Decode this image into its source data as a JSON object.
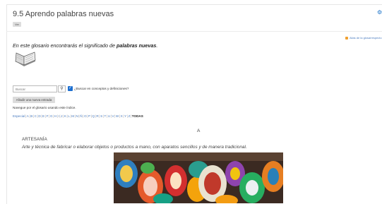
{
  "page": {
    "title": "9.5 Aprendo palabras nuevas",
    "edit_badge": "Ver"
  },
  "links": {
    "rss": "Alias de la glosa/respecto"
  },
  "intro": {
    "prefix": "En este glosario encontrarás el significado de ",
    "highlight": "palabras nuevas",
    "suffix": "."
  },
  "search": {
    "placeholder": "Buscar",
    "button_icon": "search-icon",
    "checkbox_label": "¿Buscar en conceptos y definiciones?",
    "checkbox_checked": true
  },
  "add_entry": {
    "label": "Añadir una nueva entrada"
  },
  "browse": {
    "text": "Navegue por el glosario usando este índice."
  },
  "letter_index": {
    "items": [
      "Especial",
      "A",
      "B",
      "C",
      "D",
      "E",
      "F",
      "G",
      "H",
      "I",
      "J",
      "K",
      "L",
      "M",
      "N",
      "Ñ",
      "O",
      "P",
      "Q",
      "R",
      "S",
      "T",
      "U",
      "V",
      "W",
      "X",
      "Y",
      "Z",
      "TODAS"
    ],
    "active": "TODAS"
  },
  "entries": {
    "letter": "A",
    "term": "ARTESANÍA",
    "definition": "Arte y técnica de fabricar o elaborar objetos o productos a mano, con aparatos sencillos y de manera tradicional."
  },
  "colors": {
    "accent": "#1d6fd0",
    "link": "#4a7bbf"
  }
}
